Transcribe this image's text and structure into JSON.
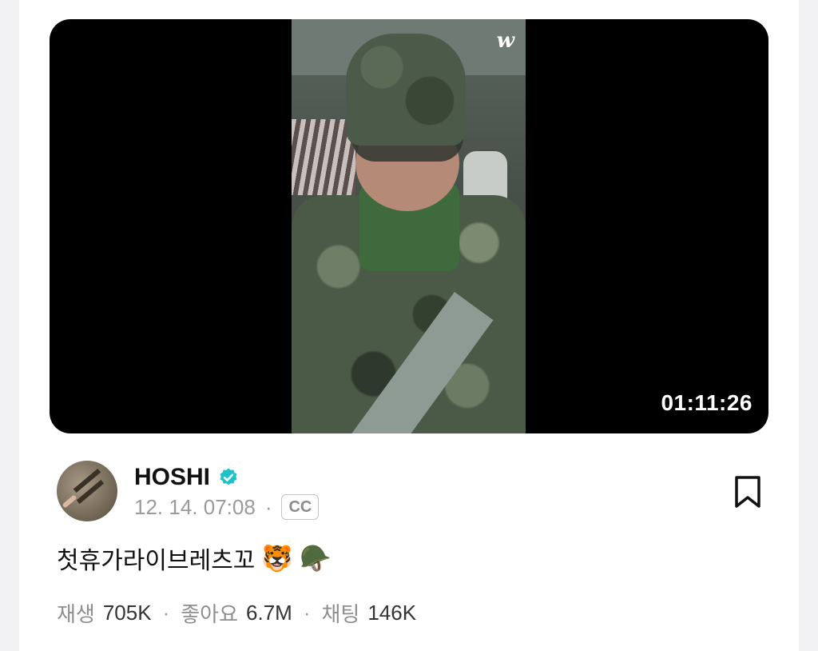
{
  "video": {
    "watermark": "w",
    "duration": "01:11:26"
  },
  "post": {
    "author": "HOSHI",
    "timestamp": "12. 14. 07:08",
    "separator": "·",
    "cc_label": "CC",
    "title": "첫휴가라이브레츠꼬",
    "title_emoji_1": "🐯",
    "title_emoji_2": "🪖"
  },
  "stats": {
    "plays_label": "재생",
    "plays_value": "705K",
    "likes_label": "좋아요",
    "likes_value": "6.7M",
    "chat_label": "채팅",
    "chat_value": "146K",
    "separator": "·"
  },
  "colors": {
    "verified": "#1fc1c8",
    "background": "#ffffff",
    "video_bg": "#000000"
  }
}
